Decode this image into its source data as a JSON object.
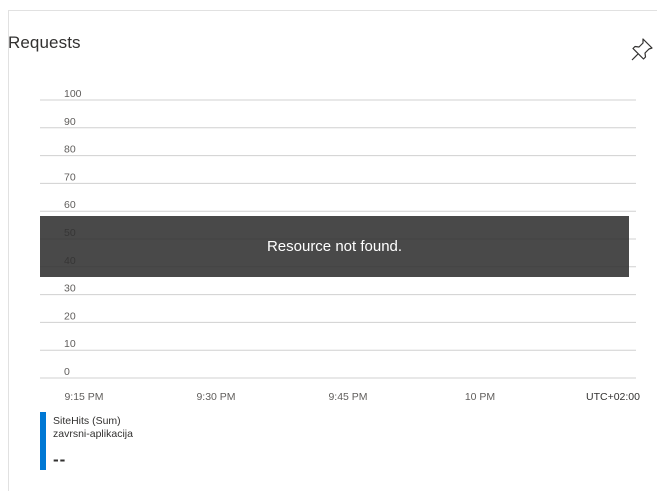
{
  "card": {
    "title": "Requests",
    "pin_icon": "pin-icon"
  },
  "chart_data": {
    "type": "line",
    "title": "Requests",
    "y_ticks": [
      "100",
      "90",
      "80",
      "70",
      "60",
      "50",
      "40",
      "30",
      "20",
      "10",
      "0"
    ],
    "ylim": [
      0,
      100
    ],
    "x_ticks": [
      "9:15 PM",
      "9:30 PM",
      "9:45 PM",
      "10 PM"
    ],
    "timezone": "UTC+02:00",
    "grid": true,
    "series": [
      {
        "name": "SiteHits (Sum)",
        "values": []
      }
    ]
  },
  "overlay": {
    "message": "Resource not found."
  },
  "legend": {
    "metric": "SiteHits (Sum)",
    "resource": "zavrsni-aplikacija",
    "value": "--",
    "color": "#0078d4"
  },
  "colors": {
    "grid": "#d0d0d0",
    "tick_text": "#605e5c",
    "accent": "#0078d4"
  }
}
